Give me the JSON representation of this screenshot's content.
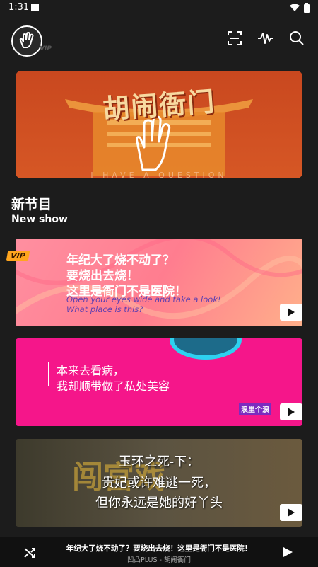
{
  "status": {
    "time": "1:31"
  },
  "header": {
    "logo_badge": "VIP"
  },
  "banner": {
    "title": "胡闹衙门",
    "subtitle": "I HAVE A QUESTION"
  },
  "section": {
    "title": "新节目",
    "subtitle": "New show"
  },
  "cards": [
    {
      "badge": "VIP",
      "lines": [
        "年纪大了烧不动了？",
        "要烧出去烧！",
        "这里是衙门不是医院！"
      ],
      "en_lines": [
        "Open your eyes wide and take a look!",
        "What place is this?"
      ]
    },
    {
      "lines": [
        "本来去看病，",
        "我却顺带做了私处美容"
      ],
      "logo": "浪里个浪"
    },
    {
      "bg_text": "闯宫戏",
      "lines": [
        "玉环之死-下：",
        "贵妃或许难逃一死，",
        "但你永远是她的好丫头"
      ]
    }
  ],
  "now_playing": {
    "title": "年纪大了烧不动了？要烧出去烧！这里是衙门不是医院！",
    "subtitle": "凹凸PLUS - 胡闹衙门"
  },
  "colors": {
    "background": "#1c1c1c",
    "banner": "#d65725",
    "card2": "#f5168a",
    "vip": "#ffa51e"
  }
}
